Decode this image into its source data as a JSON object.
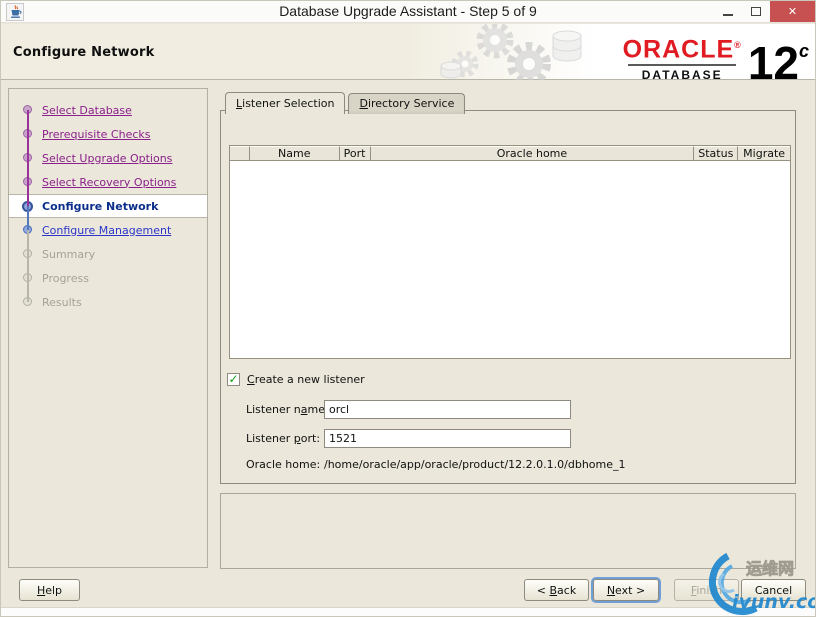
{
  "window": {
    "title": "Database Upgrade Assistant - Step 5 of 9",
    "close_glyph": "✕"
  },
  "header": {
    "title": "Configure Network",
    "brand": {
      "oracle": "ORACLE",
      "registered": "®",
      "database": "DATABASE",
      "version_number": "12",
      "version_letter": "c"
    }
  },
  "sidebar": {
    "steps": [
      {
        "label": "Select Database",
        "state": "visited"
      },
      {
        "label": "Prerequisite Checks",
        "state": "visited"
      },
      {
        "label": "Select Upgrade Options",
        "state": "visited"
      },
      {
        "label": "Select Recovery Options",
        "state": "visited"
      },
      {
        "label": "Configure Network",
        "state": "current"
      },
      {
        "label": "Configure Management",
        "state": "next"
      },
      {
        "label": "Summary",
        "state": "disabled"
      },
      {
        "label": "Progress",
        "state": "disabled"
      },
      {
        "label": "Results",
        "state": "disabled"
      }
    ]
  },
  "main": {
    "tabs": [
      {
        "key": "L",
        "rest": "istener Selection",
        "active": true
      },
      {
        "key": "D",
        "rest": "irectory Service",
        "active": false
      }
    ],
    "table": {
      "columns": [
        "",
        "Name",
        "Port",
        "Oracle home",
        "Status",
        "Migrate"
      ],
      "rows": []
    },
    "create_listener": {
      "key": "C",
      "rest": "reate a new listener",
      "checked": true,
      "check_glyph": "✓"
    },
    "fields": {
      "listener_name": {
        "label_pre": "Listener n",
        "label_key": "a",
        "label_post": "me:",
        "value": "orcl"
      },
      "listener_port": {
        "label_pre": "Listener ",
        "label_key": "p",
        "label_post": "ort:",
        "value": "1521"
      },
      "oracle_home": {
        "label": "Oracle home:",
        "value": "/home/oracle/app/oracle/product/12.2.0.1.0/dbhome_1"
      }
    }
  },
  "footer": {
    "help": {
      "key": "H",
      "rest": "elp"
    },
    "back": {
      "pre": "< ",
      "key": "B",
      "rest": "ack"
    },
    "next": {
      "key": "N",
      "rest": "ext >"
    },
    "finish": {
      "key": "F",
      "rest": "inish"
    },
    "cancel": {
      "label": "Cancel"
    }
  },
  "watermark": {
    "cn": "运维网",
    "domain": "iyunv.com"
  },
  "colors": {
    "oracle_red": "#e11b22",
    "link_visited": "#8b1f8b",
    "link_next": "#2d35c8",
    "current_step": "#0b2e8c",
    "close_button": "#c75050",
    "watermark_blue": "#1e87cf",
    "check_green": "#18a018",
    "panel_beige": "#ebe8db"
  }
}
